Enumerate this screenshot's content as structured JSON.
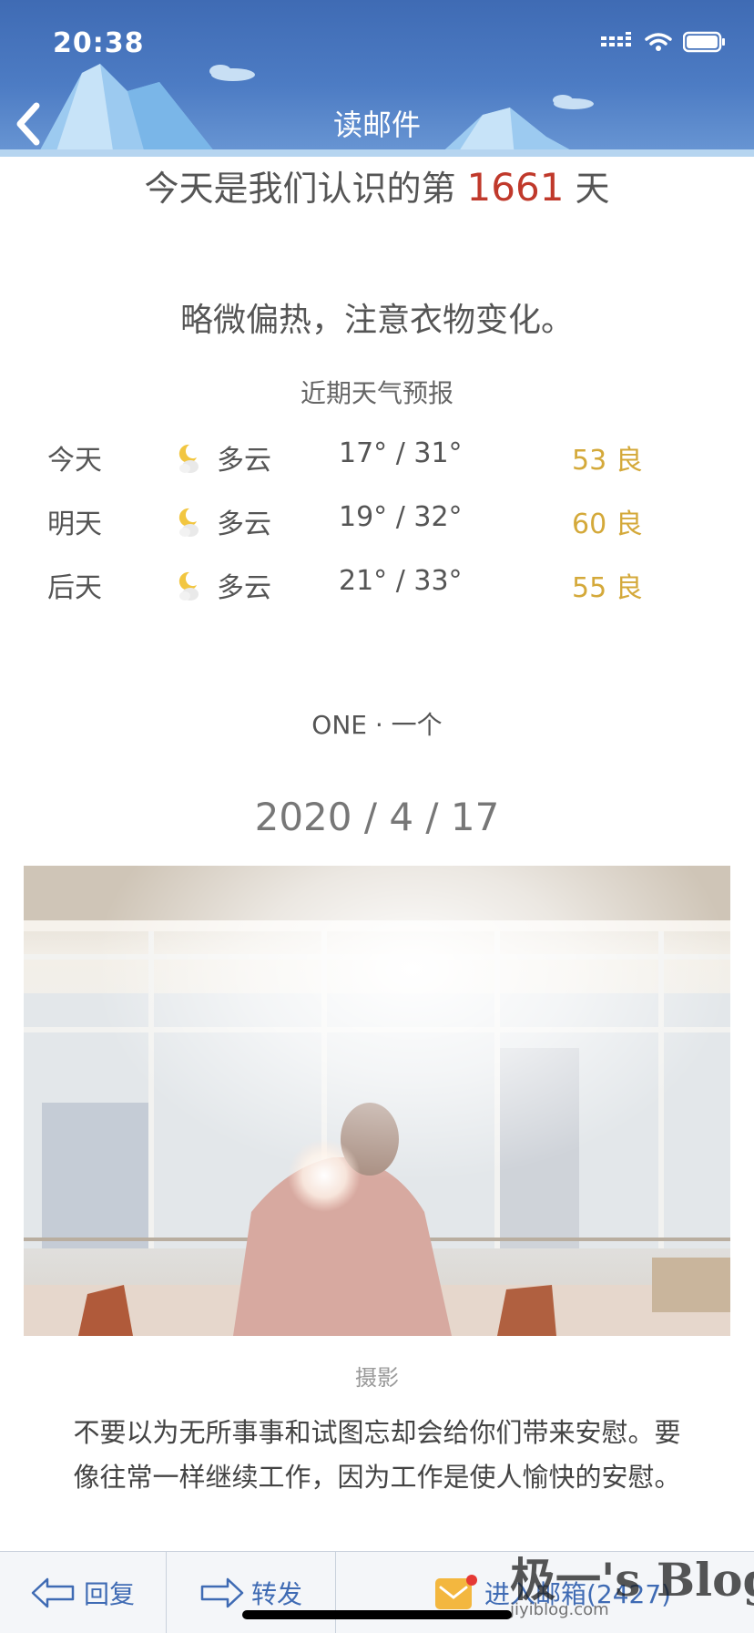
{
  "status_bar": {
    "time": "20:38"
  },
  "nav": {
    "title": "读邮件"
  },
  "greeting": {
    "prefix": "今天是我们认识的第 ",
    "days": "1661",
    "suffix": " 天"
  },
  "tip": "略微偏热，注意衣物变化。",
  "forecast": {
    "title": "近期天气预报",
    "rows": [
      {
        "day": "今天",
        "icon": "partly-cloudy-night-icon",
        "condition": "多云",
        "temp": "17° / 31°",
        "aqi": "53 良"
      },
      {
        "day": "明天",
        "icon": "partly-cloudy-night-icon",
        "condition": "多云",
        "temp": "19° / 32°",
        "aqi": "60 良"
      },
      {
        "day": "后天",
        "icon": "partly-cloudy-night-icon",
        "condition": "多云",
        "temp": "21° / 33°",
        "aqi": "55 良"
      }
    ]
  },
  "one": {
    "label": "ONE · 一个",
    "date": "2020 / 4 / 17"
  },
  "photo": {
    "caption": "摄影"
  },
  "quote": "不要以为无所事事和试图忘却会给你们带来安慰。要像往常一样继续工作，因为工作是使人愉快的安慰。",
  "toolbar": {
    "reply": "回复",
    "forward": "转发",
    "inbox": "进入邮箱(2427)"
  },
  "watermark": {
    "title": "极一's Blog",
    "url": "jiyiblog.com"
  },
  "colors": {
    "header": "#4d7cc4",
    "accent": "#3f6bb4",
    "highlight": "#c0392b",
    "aqi": "#d4a93a"
  }
}
